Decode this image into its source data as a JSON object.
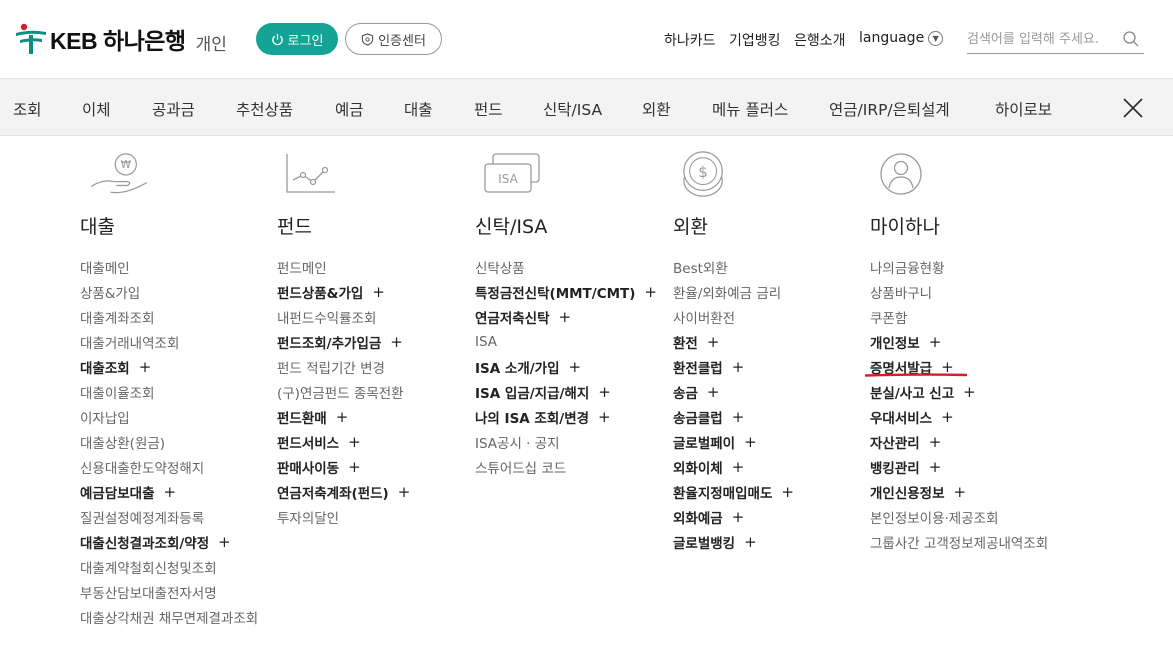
{
  "header": {
    "logo_text": "KEB 하나은행",
    "logo_sub": "개인",
    "login_label": "로그인",
    "cert_label": "인증센터",
    "util_links": [
      "하나카드",
      "기업뱅킹",
      "은행소개"
    ],
    "language_label": "language",
    "search_placeholder": "검색어를 입력해 주세요.",
    "accent_color": "#14a394"
  },
  "gnb": {
    "items": [
      "조회",
      "이체",
      "공과금",
      "추천상품",
      "예금",
      "대출",
      "펀드",
      "신탁/ISA",
      "외환",
      "메뉴 플러스",
      "연금/IRP/은퇴설계",
      "하이로보"
    ]
  },
  "menu": {
    "columns": [
      {
        "icon": "hand-coin-icon",
        "title": "대출",
        "items": [
          {
            "label": "대출메인",
            "bold": false,
            "plus": false
          },
          {
            "label": "상품&가입",
            "bold": false,
            "plus": false
          },
          {
            "label": "대출계좌조회",
            "bold": false,
            "plus": false
          },
          {
            "label": "대출거래내역조회",
            "bold": false,
            "plus": false
          },
          {
            "label": "대출조회",
            "bold": true,
            "plus": true
          },
          {
            "label": "대출이율조회",
            "bold": false,
            "plus": false
          },
          {
            "label": "이자납입",
            "bold": false,
            "plus": false
          },
          {
            "label": "대출상환(원금)",
            "bold": false,
            "plus": false
          },
          {
            "label": "신용대출한도약정해지",
            "bold": false,
            "plus": false
          },
          {
            "label": "예금담보대출",
            "bold": true,
            "plus": true
          },
          {
            "label": "질권설정예정계좌등록",
            "bold": false,
            "plus": false
          },
          {
            "label": "대출신청결과조회/약정",
            "bold": true,
            "plus": true
          },
          {
            "label": "대출계약철회신청및조회",
            "bold": false,
            "plus": false
          },
          {
            "label": "부동산담보대출전자서명",
            "bold": false,
            "plus": false
          },
          {
            "label": "대출상각채권 채무면제결과조회",
            "bold": false,
            "plus": false
          }
        ]
      },
      {
        "icon": "line-chart-icon",
        "title": "펀드",
        "items": [
          {
            "label": "펀드메인",
            "bold": false,
            "plus": false
          },
          {
            "label": "펀드상품&가입",
            "bold": true,
            "plus": true
          },
          {
            "label": "내펀드수익률조회",
            "bold": false,
            "plus": false
          },
          {
            "label": "펀드조회/추가입금",
            "bold": true,
            "plus": true
          },
          {
            "label": "펀드 적립기간 변경",
            "bold": false,
            "plus": false
          },
          {
            "label": "(구)연금펀드 종목전환",
            "bold": false,
            "plus": false
          },
          {
            "label": "펀드환매",
            "bold": true,
            "plus": true
          },
          {
            "label": "펀드서비스",
            "bold": true,
            "plus": true
          },
          {
            "label": "판매사이동",
            "bold": true,
            "plus": true
          },
          {
            "label": "연금저축계좌(펀드)",
            "bold": true,
            "plus": true
          },
          {
            "label": "투자의달인",
            "bold": false,
            "plus": false
          }
        ]
      },
      {
        "icon": "isa-card-icon",
        "icon_text": "ISA",
        "title": "신탁/ISA",
        "items": [
          {
            "label": "신탁상품",
            "bold": false,
            "plus": false
          },
          {
            "label": "특정금전신탁(MMT/CMT)",
            "bold": true,
            "plus": true
          },
          {
            "label": "연금저축신탁",
            "bold": true,
            "plus": true
          },
          {
            "label": "ISA",
            "bold": false,
            "plus": false
          },
          {
            "label": "ISA 소개/가입",
            "bold": true,
            "plus": true
          },
          {
            "label": "ISA 입금/지급/해지",
            "bold": true,
            "plus": true
          },
          {
            "label": "나의 ISA 조회/변경",
            "bold": true,
            "plus": true
          },
          {
            "label": "ISA공시 · 공지",
            "bold": false,
            "plus": false
          },
          {
            "label": "스튜어드십 코드",
            "bold": false,
            "plus": false
          }
        ]
      },
      {
        "icon": "dollar-coin-icon",
        "title": "외환",
        "items": [
          {
            "label": "Best외환",
            "bold": false,
            "plus": false
          },
          {
            "label": "환율/외화예금 금리",
            "bold": false,
            "plus": false
          },
          {
            "label": "사이버환전",
            "bold": false,
            "plus": false
          },
          {
            "label": "환전",
            "bold": true,
            "plus": true
          },
          {
            "label": "환전클럽",
            "bold": true,
            "plus": true
          },
          {
            "label": "송금",
            "bold": true,
            "plus": true
          },
          {
            "label": "송금클럽",
            "bold": true,
            "plus": true
          },
          {
            "label": "글로벌페이",
            "bold": true,
            "plus": true
          },
          {
            "label": "외화이체",
            "bold": true,
            "plus": true
          },
          {
            "label": "환율지정매입매도",
            "bold": true,
            "plus": true
          },
          {
            "label": "외화예금",
            "bold": true,
            "plus": true
          },
          {
            "label": "글로벌뱅킹",
            "bold": true,
            "plus": true
          }
        ]
      },
      {
        "icon": "user-profile-icon",
        "title": "마이하나",
        "items": [
          {
            "label": "나의금융현황",
            "bold": false,
            "plus": false
          },
          {
            "label": "상품바구니",
            "bold": false,
            "plus": false
          },
          {
            "label": "쿠폰함",
            "bold": false,
            "plus": false
          },
          {
            "label": "개인정보",
            "bold": true,
            "plus": true
          },
          {
            "label": "증명서발급",
            "bold": true,
            "plus": true
          },
          {
            "label": "분실/사고 신고",
            "bold": true,
            "plus": true
          },
          {
            "label": "우대서비스",
            "bold": true,
            "plus": true
          },
          {
            "label": "자산관리",
            "bold": true,
            "plus": true
          },
          {
            "label": "뱅킹관리",
            "bold": true,
            "plus": true
          },
          {
            "label": "개인신용정보",
            "bold": true,
            "plus": true
          },
          {
            "label": "본인정보이용·제공조회",
            "bold": false,
            "plus": false
          },
          {
            "label": "그룹사간 고객정보제공내역조회",
            "bold": false,
            "plus": false
          }
        ]
      }
    ],
    "highlight_color": "#d0202a"
  }
}
